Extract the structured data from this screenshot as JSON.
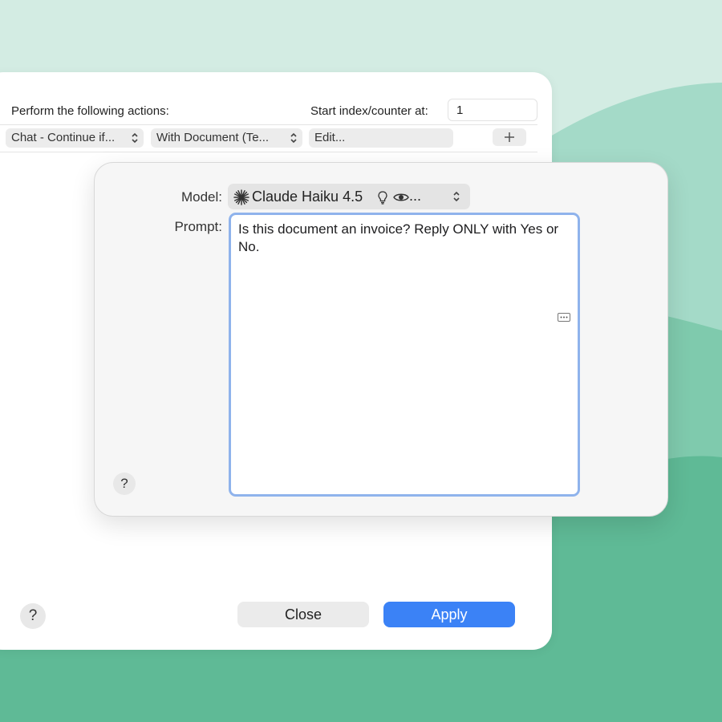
{
  "main_dialog": {
    "perform_label": "Perform the following actions:",
    "start_index_label": "Start index/counter at:",
    "start_index_value": "1",
    "action_popup": "Chat - Continue if...",
    "document_popup": "With Document (Te...",
    "edit_button": "Edit...",
    "add_icon": "plus-icon",
    "help_label": "?",
    "close_label": "Close",
    "apply_label": "Apply"
  },
  "popover": {
    "model_label": "Model:",
    "model_icon": "claude-sparkle-icon",
    "model_name": "Claude Haiku 4.5",
    "model_capability_icons": [
      "lightbulb-icon",
      "eye-icon"
    ],
    "model_more": "...",
    "prompt_label": "Prompt:",
    "prompt_text": "Is this document an invoice? Reply ONLY with Yes or No.",
    "help_label": "?"
  },
  "colors": {
    "background_light": "#d3ece3",
    "background_mid": "#a4dac8",
    "background_dark": "#5fba96",
    "accent": "#3b82f6",
    "focus_ring": "#8fb3ec"
  }
}
